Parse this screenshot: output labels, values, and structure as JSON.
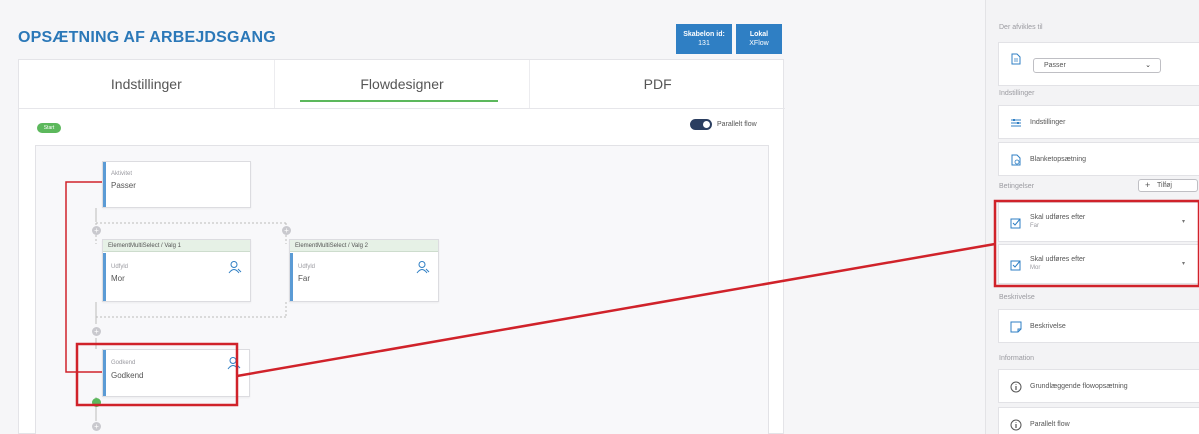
{
  "header": {
    "title": "OPSÆTNING AF ARBEJDSGANG",
    "template_badge_label": "Skabelon id:",
    "template_badge_value": "131",
    "local_badge_label": "Lokal",
    "local_badge_value": "XFlow"
  },
  "tabs": [
    {
      "label": "Indstillinger"
    },
    {
      "label": "Flowdesigner"
    },
    {
      "label": "PDF"
    }
  ],
  "designer": {
    "start_pill": "Start",
    "parallel_toggle_label": "Parallelt flow",
    "nodes": {
      "activity": {
        "small": "Aktivitet",
        "big": "Passer"
      },
      "multiselect1": {
        "header": "ElementMultiSelect / Valg 1",
        "small": "Udfyld",
        "big": "Mor"
      },
      "multiselect2": {
        "header": "ElementMultiSelect / Valg 2",
        "small": "Udfyld",
        "big": "Far"
      },
      "approve": {
        "small": "Godkend",
        "big": "Godkend"
      }
    }
  },
  "sidebar": {
    "assigned_section": "Der afvikles til",
    "assigned_select": "Passer",
    "settings_section": "Indstillinger",
    "settings_items": [
      {
        "label": "Indstillinger",
        "icon": "list-settings-icon"
      },
      {
        "label": "Blanketopsætning",
        "icon": "form-settings-icon"
      }
    ],
    "conditions_section": "Betingelser",
    "add_button": "Tilføj",
    "conditions": [
      {
        "label": "Skal udføres efter",
        "sub": "Far"
      },
      {
        "label": "Skal udføres efter",
        "sub": "Mor"
      }
    ],
    "description_section": "Beskrivelse",
    "description_item": "Beskrivelse",
    "information_section": "Information",
    "info_items": [
      {
        "label": "Grundlæggende flowopsætning"
      },
      {
        "label": "Parallelt flow"
      }
    ]
  },
  "colors": {
    "brand_blue": "#2f7fc4",
    "title_blue": "#2b78b8",
    "accent_green": "#5cb85c",
    "highlight_red": "#d0222a",
    "node_bar_blue": "#5b9bd5"
  }
}
